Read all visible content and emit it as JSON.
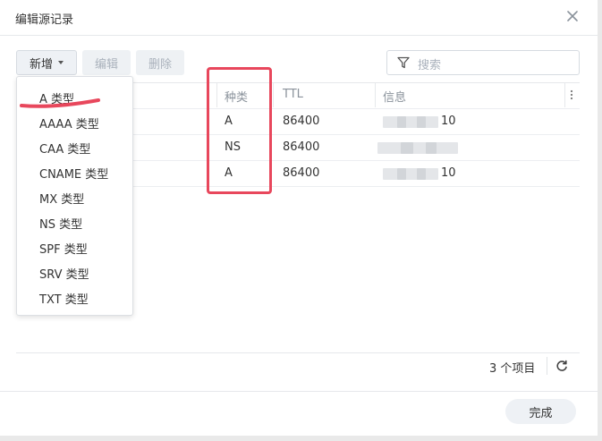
{
  "dialog": {
    "title": "编辑源记录"
  },
  "toolbar": {
    "add_label": "新增",
    "edit_label": "编辑",
    "delete_label": "删除"
  },
  "search": {
    "placeholder": "搜索"
  },
  "columns": [
    {
      "label": ""
    },
    {
      "label": "种类"
    },
    {
      "label": "TTL"
    },
    {
      "label": "信息"
    }
  ],
  "rows": [
    {
      "type": "A",
      "ttl": "86400",
      "info": "10"
    },
    {
      "type": "NS",
      "ttl": "86400",
      "info": ""
    },
    {
      "type": "A",
      "ttl": "86400",
      "info": "10"
    }
  ],
  "add_menu": {
    "items": [
      {
        "label": "A 类型"
      },
      {
        "label": "AAAA 类型"
      },
      {
        "label": "CAA 类型"
      },
      {
        "label": "CNAME 类型"
      },
      {
        "label": "MX 类型"
      },
      {
        "label": "NS 类型"
      },
      {
        "label": "SPF 类型"
      },
      {
        "label": "SRV 类型"
      },
      {
        "label": "TXT 类型"
      }
    ]
  },
  "footer": {
    "count_text": "3 个项目",
    "done_label": "完成"
  },
  "colors": {
    "highlight": "#e8475c",
    "muted_text": "#8a929b"
  }
}
